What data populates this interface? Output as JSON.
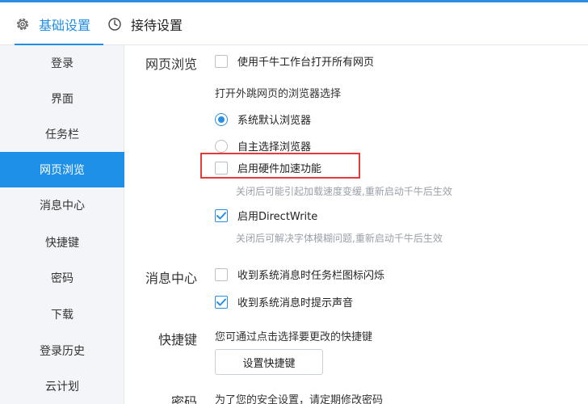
{
  "tabs": [
    {
      "label": "基础设置",
      "icon": "gear-icon",
      "active": true
    },
    {
      "label": "接待设置",
      "icon": "clock-icon",
      "active": false
    }
  ],
  "accent_color": "#1e90e8",
  "highlight_color": "#e53a3a",
  "sidebar": {
    "items": [
      {
        "label": "登录",
        "active": false
      },
      {
        "label": "界面",
        "active": false
      },
      {
        "label": "任务栏",
        "active": false
      },
      {
        "label": "网页浏览",
        "active": true
      },
      {
        "label": "消息中心",
        "active": false
      },
      {
        "label": "快捷键",
        "active": false
      },
      {
        "label": "密码",
        "active": false
      },
      {
        "label": "下载",
        "active": false
      },
      {
        "label": "登录历史",
        "active": false
      },
      {
        "label": "云计划",
        "active": false
      }
    ]
  },
  "web_browsing": {
    "title": "网页浏览",
    "open_all_pages": {
      "label": "使用千牛工作台打开所有网页",
      "checked": false
    },
    "browser_choice_label": "打开外跳网页的浏览器选择",
    "default_browser": {
      "label": "系统默认浏览器",
      "selected": true
    },
    "custom_browser": {
      "label": "自主选择浏览器",
      "selected": false
    },
    "hardware_accel": {
      "label": "启用硬件加速功能",
      "checked": false
    },
    "hardware_accel_hint": "关闭后可能引起加载速度变缓,重新启动千牛后生效",
    "directwrite": {
      "label": "启用DirectWrite",
      "checked": true
    },
    "directwrite_hint": "关闭后可解决字体模糊问题,重新启动千牛后生效"
  },
  "message_center": {
    "title": "消息中心",
    "flash_taskbar": {
      "label": "收到系统消息时任务栏图标闪烁",
      "checked": false
    },
    "sound_alert": {
      "label": "收到系统消息时提示声音",
      "checked": true
    }
  },
  "shortcuts": {
    "title": "快捷键",
    "description": "您可通过点击选择要更改的快捷键",
    "button_label": "设置快捷键"
  },
  "password": {
    "title": "密码",
    "description": "为了您的安全设置，请定期修改密码"
  }
}
